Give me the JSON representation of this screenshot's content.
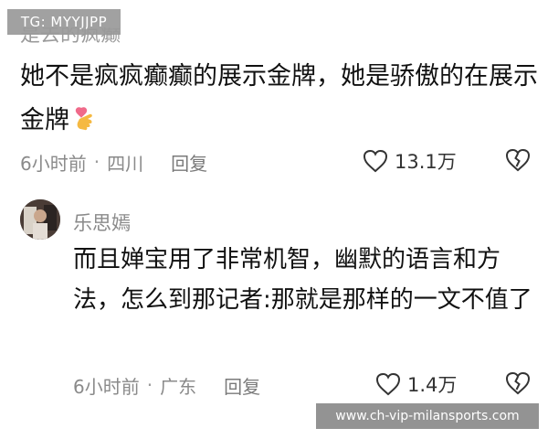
{
  "overlay": {
    "tg_label": "TG: MYYJJPP",
    "watermark": "www.ch-vip-milansports.com"
  },
  "thread": {
    "cut_off_text": "是去的疯癫",
    "comments": [
      {
        "text": "她不是疯疯癫癫的展示金牌，她是骄傲的在展示金牌",
        "emoji": "heart-fingers-emoji",
        "time": "6小时前",
        "location": "四川",
        "reply_label": "回复",
        "like_count": "13.1万"
      },
      {
        "username": "乐思嫣",
        "text": "而且婵宝用了非常机智，幽默的语言和方法，怎么到那记者:那就是那样的一文不值了",
        "time": "6小时前",
        "location": "广东",
        "reply_label": "回复",
        "like_count": "1.4万"
      }
    ]
  },
  "colors": {
    "text": "#111111",
    "meta": "#8a8a8a",
    "emoji_pink": "#f06a8a",
    "emoji_yellow": "#f5b942"
  }
}
